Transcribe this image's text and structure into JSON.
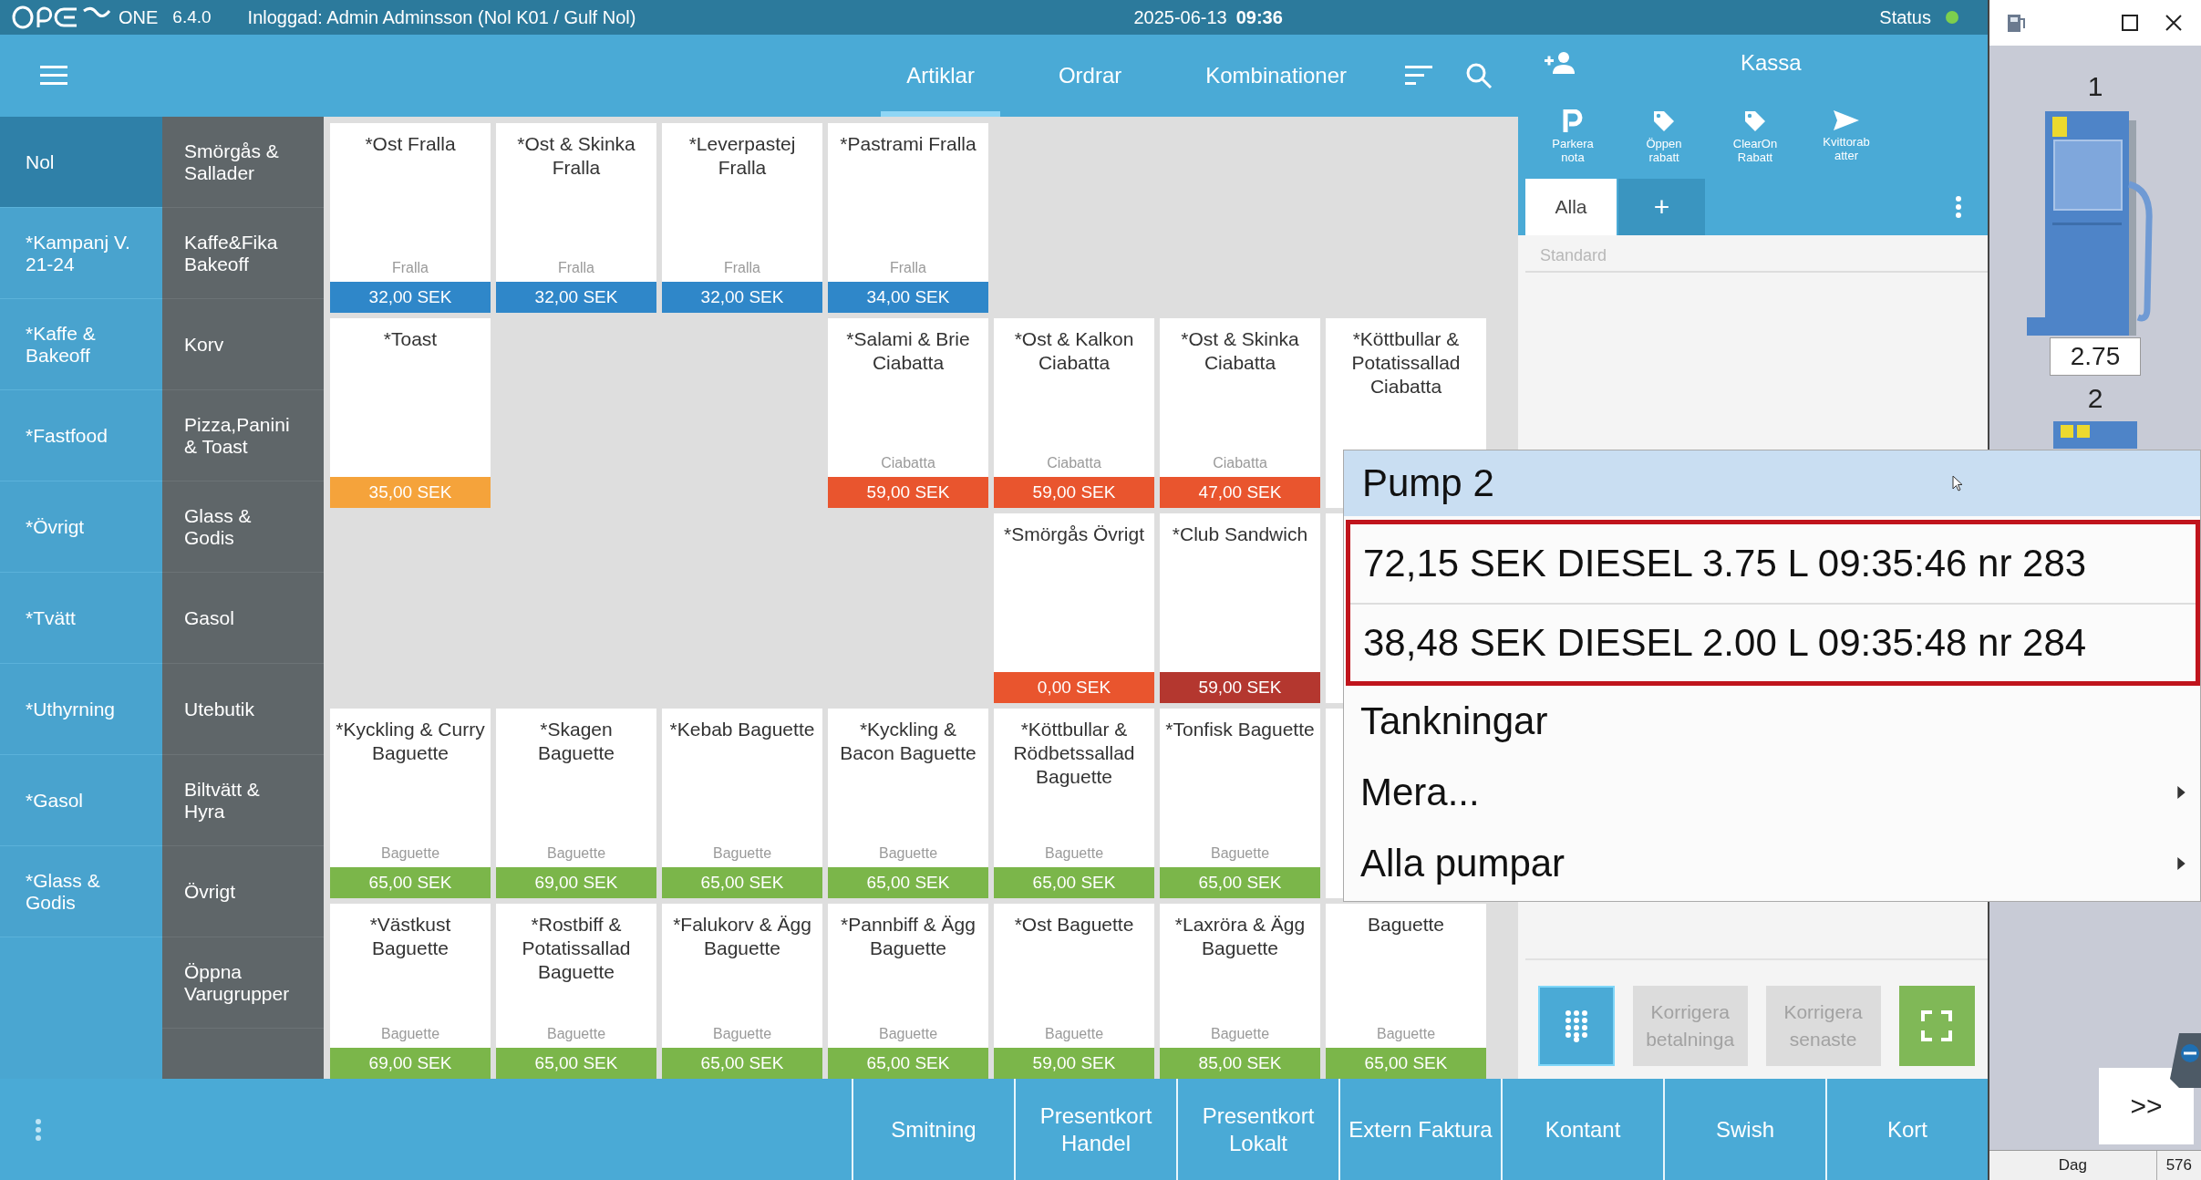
{
  "top_bar": {
    "product": "ONE",
    "version": "6.4.0",
    "login": "Inloggad: Admin Adminsson (Nol K01 / Gulf Nol)",
    "date": "2025-06-13",
    "time": "09:36",
    "status_label": "Status",
    "status_ok": true
  },
  "nav": {
    "tabs": [
      {
        "label": "Artiklar",
        "selected": true
      },
      {
        "label": "Ordrar",
        "selected": false
      },
      {
        "label": "Kombinationer",
        "selected": false
      }
    ]
  },
  "categories": [
    {
      "label": "Nol",
      "selected": true
    },
    {
      "label": "*Kampanj V. 21-24",
      "selected": false
    },
    {
      "label": "*Kaffe & Bakeoff",
      "selected": false
    },
    {
      "label": "*Fastfood",
      "selected": false
    },
    {
      "label": "*Övrigt",
      "selected": false
    },
    {
      "label": "*Tvätt",
      "selected": false
    },
    {
      "label": "*Uthyrning",
      "selected": false
    },
    {
      "label": "*Gasol",
      "selected": false
    },
    {
      "label": "*Glass & Godis",
      "selected": false
    }
  ],
  "subcategories": [
    "Smörgås & Sallader",
    "Kaffe&Fika Bakeoff",
    "Korv",
    "Pizza,Panini & Toast",
    "Glass & Godis",
    "Gasol",
    "Utebutik",
    "Biltvätt & Hyra",
    "Övrigt",
    "Öppna Varugrupper"
  ],
  "article_rows": [
    {
      "tiles": [
        {
          "kind": "item",
          "title": "*Ost Fralla",
          "group": "Fralla",
          "price": "32,00 SEK",
          "color": "#2f87c9"
        },
        {
          "kind": "item",
          "title": "*Ost & Skinka Fralla",
          "group": "Fralla",
          "price": "32,00 SEK",
          "color": "#2f87c9"
        },
        {
          "kind": "item",
          "title": "*Leverpastej Fralla",
          "group": "Fralla",
          "price": "32,00 SEK",
          "color": "#2f87c9"
        },
        {
          "kind": "item",
          "title": "*Pastrami Fralla",
          "group": "Fralla",
          "price": "34,00 SEK",
          "color": "#2f87c9"
        },
        {
          "kind": "empty"
        },
        {
          "kind": "empty"
        },
        {
          "kind": "empty"
        }
      ]
    },
    {
      "tiles": [
        {
          "kind": "item",
          "title": "*Toast",
          "price": "35,00 SEK",
          "color": "#f5a33b"
        },
        {
          "kind": "empty"
        },
        {
          "kind": "empty"
        },
        {
          "kind": "item",
          "title": "*Salami & Brie Ciabatta",
          "group": "Ciabatta",
          "price": "59,00 SEK",
          "color": "#e9552e"
        },
        {
          "kind": "item",
          "title": "*Ost & Kalkon Ciabatta",
          "group": "Ciabatta",
          "price": "59,00 SEK",
          "color": "#e9552e"
        },
        {
          "kind": "item",
          "title": "*Ost & Skinka Ciabatta",
          "group": "Ciabatta",
          "price": "47,00 SEK",
          "color": "#e9552e"
        },
        {
          "kind": "item",
          "title": "*Köttbullar & Potatissallad Ciabatta"
        }
      ]
    },
    {
      "tiles": [
        {
          "kind": "empty"
        },
        {
          "kind": "empty"
        },
        {
          "kind": "empty"
        },
        {
          "kind": "empty"
        },
        {
          "kind": "item",
          "title": "*Smörgås Övrigt",
          "price": "0,00 SEK",
          "color": "#e9552e"
        },
        {
          "kind": "item",
          "title": "*Club Sandwich",
          "price": "59,00 SEK",
          "color": "#b4372f"
        },
        {
          "kind": "item"
        }
      ]
    },
    {
      "tiles": [
        {
          "kind": "item",
          "title": "*Kyckling & Curry Baguette",
          "group": "Baguette",
          "price": "65,00 SEK",
          "color": "#7bb64a"
        },
        {
          "kind": "item",
          "title": "*Skagen Baguette",
          "group": "Baguette",
          "price": "69,00 SEK",
          "color": "#7bb64a"
        },
        {
          "kind": "item",
          "title": "*Kebab Baguette",
          "group": "Baguette",
          "price": "65,00 SEK",
          "color": "#7bb64a"
        },
        {
          "kind": "item",
          "title": "*Kyckling & Bacon Baguette",
          "group": "Baguette",
          "price": "65,00 SEK",
          "color": "#7bb64a"
        },
        {
          "kind": "item",
          "title": "*Köttbullar & Rödbetssallad Baguette",
          "group": "Baguette",
          "price": "65,00 SEK",
          "color": "#7bb64a"
        },
        {
          "kind": "item",
          "title": "*Tonfisk Baguette",
          "group": "Baguette",
          "price": "65,00 SEK",
          "color": "#7bb64a"
        },
        {
          "kind": "item"
        }
      ]
    },
    {
      "tiles": [
        {
          "kind": "item",
          "title": "*Västkust Baguette",
          "group": "Baguette",
          "price": "69,00 SEK",
          "color": "#7bb64a"
        },
        {
          "kind": "item",
          "title": "*Rostbiff & Potatissallad Baguette",
          "group": "Baguette",
          "price": "65,00 SEK",
          "color": "#7bb64a"
        },
        {
          "kind": "item",
          "title": "*Falukorv & Ägg Baguette",
          "group": "Baguette",
          "price": "65,00 SEK",
          "color": "#7bb64a"
        },
        {
          "kind": "item",
          "title": "*Pannbiff & Ägg Baguette",
          "group": "Baguette",
          "price": "65,00 SEK",
          "color": "#7bb64a"
        },
        {
          "kind": "item",
          "title": "*Ost Baguette",
          "group": "Baguette",
          "price": "59,00 SEK",
          "color": "#7bb64a"
        },
        {
          "kind": "item",
          "title": "*Laxröra & Ägg Baguette",
          "group": "Baguette",
          "price": "85,00 SEK",
          "color": "#7bb64a"
        },
        {
          "kind": "item",
          "title": "Baguette",
          "group": "Baguette",
          "price": "65,00 SEK",
          "color": "#7bb64a"
        }
      ]
    }
  ],
  "kassa": {
    "title": "Kassa",
    "actions": [
      "Parkera nota",
      "Öppen rabatt",
      "ClearOn Rabatt",
      "Kvittorab atter"
    ],
    "tabs": [
      {
        "label": "Alla",
        "selected": true
      },
      {
        "label": "+",
        "selected": false
      }
    ],
    "field": {
      "placeholder": "Standard"
    },
    "buttons": [
      {
        "kind": "keypad"
      },
      {
        "kind": "text",
        "label": "Korrigera betalninga",
        "disabled": true
      },
      {
        "kind": "text",
        "label": "Korrigera senaste",
        "disabled": true
      },
      {
        "kind": "fullscreen"
      }
    ]
  },
  "payment_buttons": [
    "Smitning",
    "Presentkort Handel",
    "Presentkort Lokalt",
    "Extern Faktura",
    "Kontant",
    "Swish",
    "Kort"
  ],
  "pump_menu": {
    "title": "Pump 2",
    "items": [
      {
        "label": "72,15 SEK DIESEL 3.75 L 09:35:46 nr 283",
        "highlighted": true,
        "submenu": false
      },
      {
        "label": "38,48 SEK DIESEL 2.00 L 09:35:48 nr 284",
        "highlighted": true,
        "submenu": false
      },
      {
        "label": "Tankningar",
        "highlighted": false,
        "submenu": false
      },
      {
        "label": "Mera...",
        "highlighted": false,
        "submenu": true
      },
      {
        "label": "Alla pumpar",
        "highlighted": false,
        "submenu": true
      }
    ]
  },
  "pump_window": {
    "pumps": [
      {
        "number": "1",
        "reading": "2.75"
      },
      {
        "number": "2"
      }
    ],
    "next_button": ">>",
    "status_bar": [
      "Dag",
      "576"
    ]
  }
}
